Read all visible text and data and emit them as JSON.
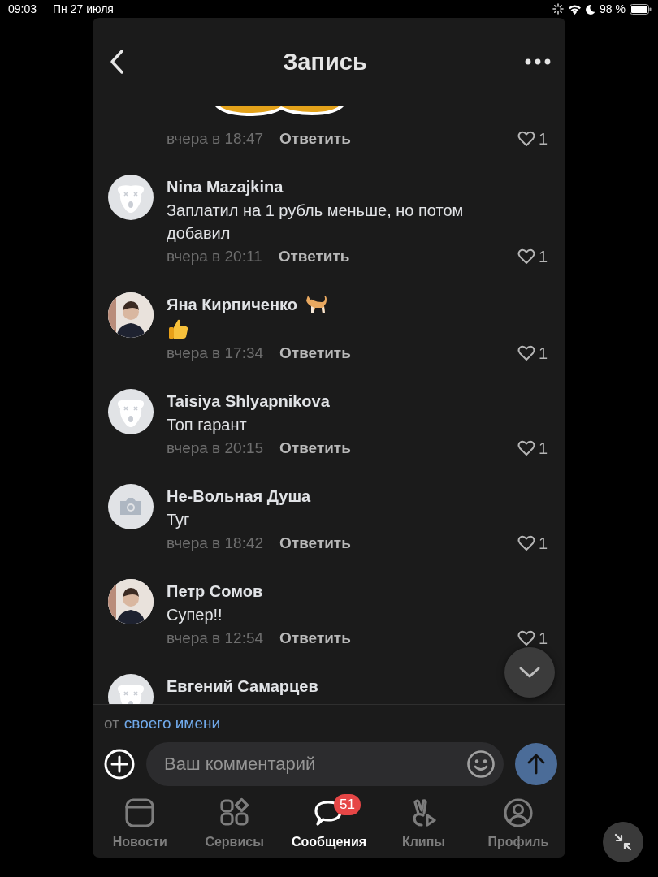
{
  "status_bar": {
    "time": "09:03",
    "date": "Пн 27 июля",
    "battery": "98 %"
  },
  "header": {
    "title": "Запись"
  },
  "comments": [
    {
      "kind": "sticker",
      "time": "вчера в 18:47",
      "reply": "Ответить",
      "likes": "1"
    },
    {
      "kind": "text",
      "avatar": {
        "kind": "deactivated"
      },
      "name": "Nina Mazajkina",
      "text": "Заплатил на 1 рубль меньше, но потом добавил",
      "time": "вчера в 20:11",
      "reply": "Ответить",
      "likes": "1"
    },
    {
      "kind": "thumbs_up",
      "avatar": {
        "kind": "photo"
      },
      "name": "Яна Кирпиченко",
      "name_emoji": true,
      "time": "вчера в 17:34",
      "reply": "Ответить",
      "likes": "1"
    },
    {
      "kind": "text",
      "avatar": {
        "kind": "deactivated"
      },
      "name": "Taisiya Shlyapnikova",
      "text": "Топ гарант",
      "time": "вчера в 20:15",
      "reply": "Ответить",
      "likes": "1"
    },
    {
      "kind": "text",
      "avatar": {
        "kind": "camera"
      },
      "name": "Не-Вольная Душа",
      "text": "Туг",
      "time": "вчера в 18:42",
      "reply": "Ответить",
      "likes": "1"
    },
    {
      "kind": "text",
      "avatar": {
        "kind": "photo"
      },
      "name": "Петр Сомов",
      "text": "Супер!!",
      "time": "вчера в 12:54",
      "reply": "Ответить",
      "likes": "1"
    },
    {
      "kind": "partial",
      "avatar": {
        "kind": "deactivated"
      },
      "name": "Евгений Самарцев"
    }
  ],
  "composer": {
    "prefix": "от",
    "link": "своего имени",
    "placeholder": "Ваш комментарий"
  },
  "tabs": [
    {
      "kind": "news",
      "label": "Новости",
      "selected": false
    },
    {
      "kind": "services",
      "label": "Сервисы",
      "selected": false
    },
    {
      "kind": "messages",
      "label": "Сообщения",
      "selected": true,
      "badge": "51"
    },
    {
      "kind": "clips",
      "label": "Клипы",
      "selected": false
    },
    {
      "kind": "profile",
      "label": "Профиль",
      "selected": false
    }
  ]
}
